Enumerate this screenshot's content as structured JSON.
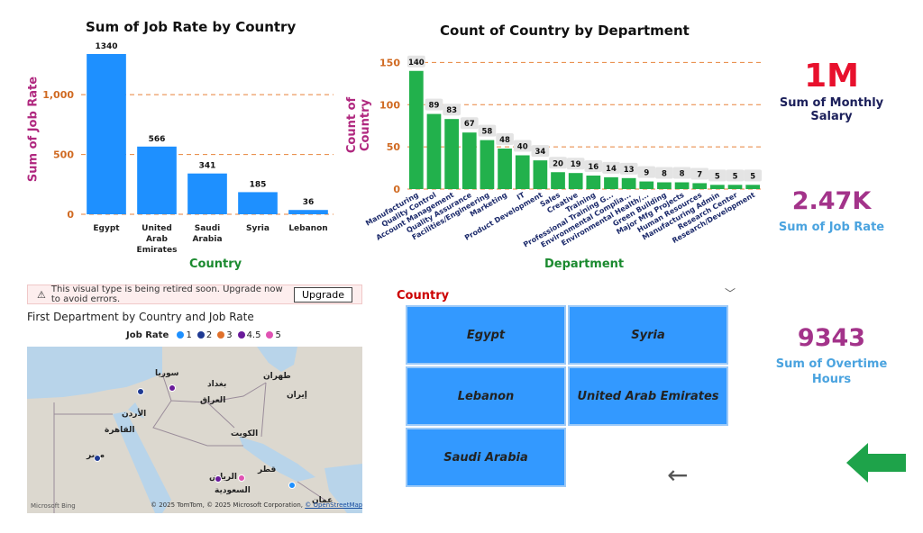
{
  "job_rate_chart": {
    "title": "Sum of Job Rate by Country",
    "ylabel": "Sum of Job Rate",
    "xlabel": "Country",
    "accent": "#1e90ff"
  },
  "department_chart": {
    "title": "Count of Country by Department",
    "ylabel": "Count of Country",
    "xlabel": "Department",
    "accent": "#22b14c"
  },
  "cards": {
    "salary": {
      "value": "1M",
      "label": "Sum of Monthly Salary",
      "value_color": "#e8112d",
      "label_color": "#1b1f5a"
    },
    "job_rate": {
      "value": "2.47K",
      "label": "Sum of Job Rate",
      "value_color": "#a3338a",
      "label_color": "#4aa3df"
    },
    "overtime": {
      "value": "9343",
      "label_line1": "Sum of Overtime",
      "label_line2": "Hours",
      "value_color": "#a3338a",
      "label_color": "#4aa3df"
    }
  },
  "warning": {
    "text": "This visual type is being retired soon. Upgrade now to avoid errors.",
    "button": "Upgrade"
  },
  "map": {
    "title": "First Department by Country and Job Rate",
    "legend_title": "Job Rate",
    "legend_items": [
      {
        "label": "1",
        "color": "#1e90ff"
      },
      {
        "label": "2",
        "color": "#1f3a93"
      },
      {
        "label": "3",
        "color": "#e0702a"
      },
      {
        "label": "4.5",
        "color": "#6a1b9a"
      },
      {
        "label": "5",
        "color": "#e052b3"
      }
    ],
    "place_labels": [
      "سوريا",
      "بغداد",
      "العراق",
      "إيران",
      "الأردن",
      "القاهرة",
      "مصر",
      "الرياض",
      "السعودية",
      "قطر",
      "الكويت",
      "عمان",
      "طهران"
    ],
    "attribution": "© 2025 TomTom, © 2025 Microsoft Corporation,",
    "attribution_link": "© OpenStreetMap",
    "bing": "Microsoft Bing"
  },
  "slicer": {
    "header": "Country",
    "header_color": "#cc0000",
    "options": [
      "Egypt",
      "Syria",
      "Lebanon",
      "United Arab Emirates",
      "Saudi Arabia"
    ]
  },
  "chart_data": [
    {
      "type": "bar",
      "title": "Sum of Job Rate by Country",
      "xlabel": "Country",
      "ylabel": "Sum of Job Rate",
      "categories": [
        "Egypt",
        "United Arab Emirates",
        "Saudi Arabia",
        "Syria",
        "Lebanon"
      ],
      "category_lines": [
        [
          "Egypt"
        ],
        [
          "United",
          "Arab",
          "Emirates"
        ],
        [
          "Saudi",
          "Arabia"
        ],
        [
          "Syria"
        ],
        [
          "Lebanon"
        ]
      ],
      "values": [
        1340,
        566,
        341,
        185,
        36
      ],
      "ylim": [
        0,
        1400
      ],
      "yticks": [
        0,
        500,
        1000
      ],
      "ytick_labels": [
        "0",
        "500",
        "1,000"
      ],
      "grid": true
    },
    {
      "type": "bar",
      "title": "Count of Country by Department",
      "xlabel": "Department",
      "ylabel": "Count of Country",
      "categories": [
        "Manufacturing",
        "Quality Control",
        "Account Management",
        "Quality Assurance",
        "Facilities/Engineering",
        "Marketing",
        "IT",
        "Product Development",
        "Sales",
        "Creative",
        "Training",
        "Professional Training G...",
        "Environmental Complia...",
        "Environmental Health/...",
        "Green Building",
        "Major Mfg Projects",
        "Human Resources",
        "Manufacturing Admin",
        "Research Center",
        "Research/Development"
      ],
      "values": [
        140,
        89,
        83,
        67,
        58,
        48,
        40,
        34,
        20,
        19,
        16,
        14,
        13,
        9,
        8,
        8,
        7,
        5,
        5,
        5
      ],
      "value_labels": [
        "140",
        "89",
        "83",
        "67",
        "58",
        "48",
        "40",
        "34",
        "20",
        "19",
        "16",
        "14",
        "13",
        "9",
        "8",
        "8",
        "7",
        "5",
        "5",
        "5"
      ],
      "ylim": [
        0,
        160
      ],
      "yticks": [
        0,
        50,
        100,
        150
      ],
      "grid": true
    }
  ]
}
